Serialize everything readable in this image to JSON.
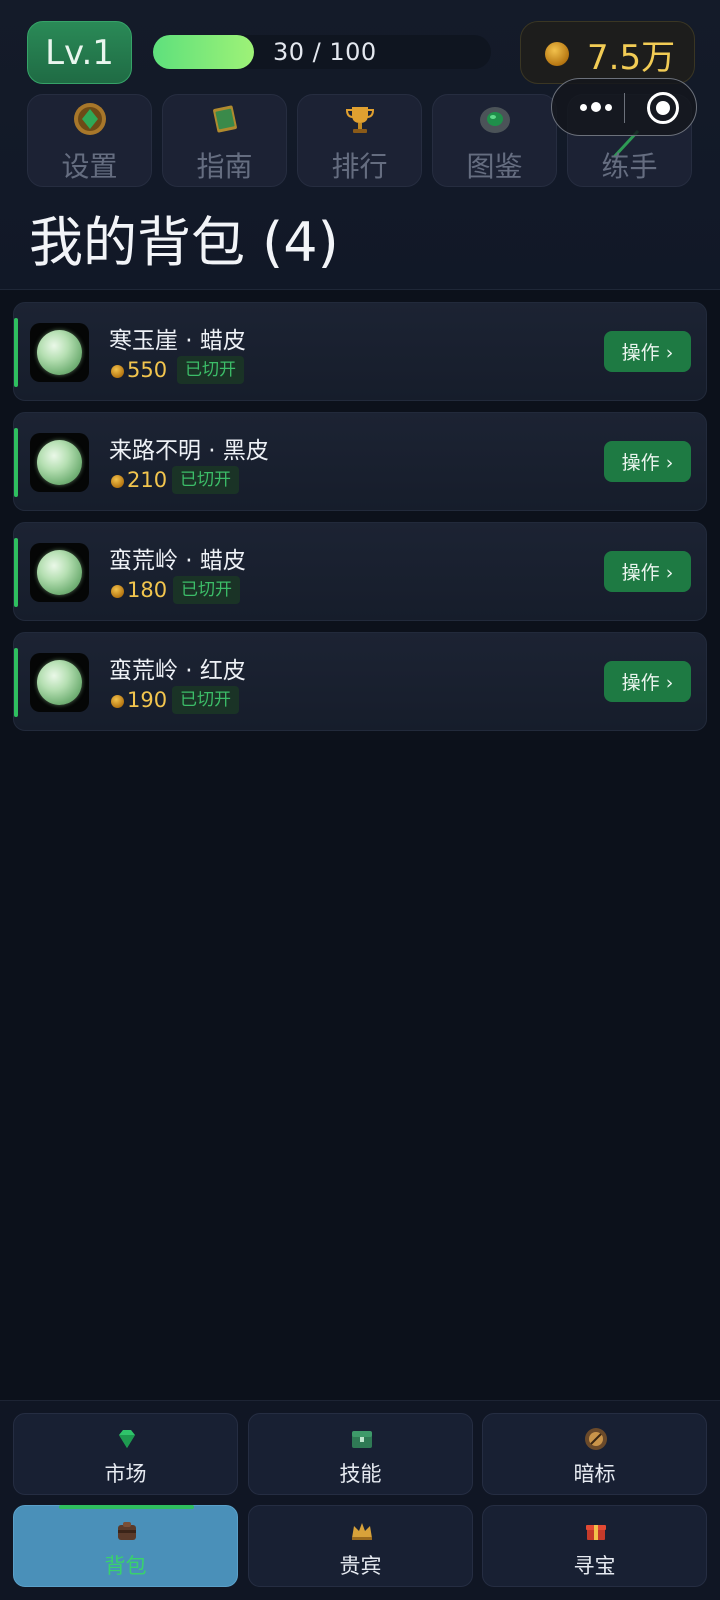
{
  "header": {
    "level": "Lv.1",
    "xp": {
      "current": 30,
      "max": 100,
      "text": "30 / 100"
    },
    "coins": "7.5万"
  },
  "nav_tiles": [
    {
      "label": "设置",
      "icon": "gear-medallion-icon"
    },
    {
      "label": "指南",
      "icon": "guide-book-icon"
    },
    {
      "label": "排行",
      "icon": "trophy-icon"
    },
    {
      "label": "图鉴",
      "icon": "stone-catalog-icon"
    },
    {
      "label": "练手",
      "icon": "practice-knife-icon"
    }
  ],
  "page_title": "我的背包 (4)",
  "items": [
    {
      "name": "寒玉崖 · 蜡皮",
      "price": "550",
      "status": "已切开",
      "action": "操作 ›"
    },
    {
      "name": "来路不明 · 黑皮",
      "price": "210",
      "status": "已切开",
      "action": "操作 ›"
    },
    {
      "name": "蛮荒岭 · 蜡皮",
      "price": "180",
      "status": "已切开",
      "action": "操作 ›"
    },
    {
      "name": "蛮荒岭 · 红皮",
      "price": "190",
      "status": "已切开",
      "action": "操作 ›"
    }
  ],
  "bottom_tabs": [
    {
      "label": "市场",
      "icon": "gem-icon"
    },
    {
      "label": "技能",
      "icon": "chest-icon"
    },
    {
      "label": "暗标",
      "icon": "bid-icon"
    },
    {
      "label": "背包",
      "icon": "backpack-icon",
      "active": true
    },
    {
      "label": "贵宾",
      "icon": "crown-icon"
    },
    {
      "label": "寻宝",
      "icon": "gift-icon"
    }
  ],
  "colors": {
    "accent_green": "#2fbf5f",
    "coin_gold": "#f2c54e",
    "active_tab": "#4a90b9"
  }
}
